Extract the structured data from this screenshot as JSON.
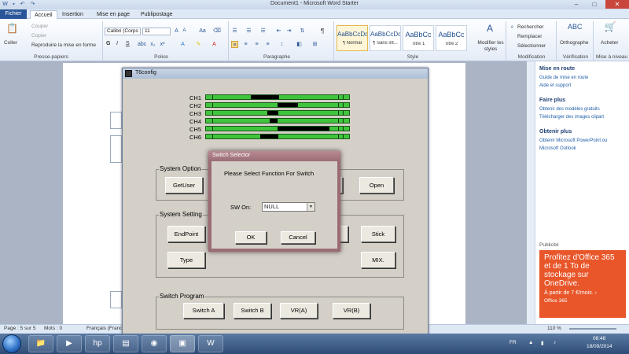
{
  "word": {
    "title": "Document1 - Microsoft Word Starter",
    "tabs": [
      "Fichier",
      "Accueil",
      "Insertion",
      "Mise en page",
      "Publipostage"
    ],
    "clipboard": {
      "paste": "Coller",
      "cut": "Couper",
      "copy": "Copier",
      "format_painter": "Reproduire la mise en forme",
      "label": "Presse-papiers"
    },
    "font": {
      "name": "Calibri (Corps",
      "size": "11",
      "label": "Police",
      "bold": "G",
      "italic": "I",
      "underline": "S"
    },
    "paragraph": {
      "label": "Paragraphe",
      "pilcrow": "¶"
    },
    "styles": {
      "label": "Style",
      "items": [
        {
          "sample": "AaBbCcDc",
          "name": "¶ Normal"
        },
        {
          "sample": "AaBbCcDc",
          "name": "¶ Sans int..."
        },
        {
          "sample": "AaBbCc",
          "name": "Titre 1"
        },
        {
          "sample": "AaBbCc",
          "name": "Titre 2"
        }
      ],
      "modify": "Modifier les styles"
    },
    "editing": {
      "find": "Rechercher",
      "replace": "Remplacer",
      "select": "Sélectionner",
      "label": "Modification"
    },
    "proofing": {
      "spelling": "Orthographe",
      "label": "Vérification"
    },
    "buy": {
      "label": "Acheter",
      "group": "Mise à niveau"
    },
    "status": {
      "page": "Page : 5 sur 5",
      "words": "Mots : 0",
      "lang": "Français (France)",
      "zoom": "110 %"
    }
  },
  "pane": {
    "get_started": "Mise en route",
    "get_started_links": [
      "Guide de mise en route",
      "Aide et support"
    ],
    "do_more": "Faire plus",
    "do_more_links": [
      "Obtenir des modèles gratuits",
      "Télécharger des images clipart"
    ],
    "get_more": "Obtenir plus",
    "get_more_links": [
      "Obtenir Microsoft PowerPoint ou",
      "Microsoft Outlook"
    ],
    "ad_label": "Publicité",
    "ad_text": "Profitez d'Office 365 et de 1 To de stockage sur OneDrive.",
    "ad_price": "À partir de 7 €/mois. ›",
    "ad_brand": "Office 365"
  },
  "t6": {
    "title": "T6config",
    "channels": [
      "CH1",
      "CH2",
      "CH3",
      "CH4",
      "CH5",
      "CH6"
    ],
    "system_option": {
      "label": "System Option",
      "getuser": "GetUser",
      "open": "Open"
    },
    "system_setting": {
      "label": "System Setting",
      "endpoint": "EndPoint",
      "type": "Type",
      "stick": "Stick",
      "mix": "MIX."
    },
    "switch_program": {
      "label": "Switch Program",
      "buttons": [
        "Switch A",
        "Switch B",
        "VR(A)",
        "VR(B)"
      ]
    }
  },
  "dialog": {
    "title": "Switch Selector",
    "prompt": "Please Select Function For  Switch",
    "sw_label": "SW On:",
    "sw_value": "NULL",
    "ok": "OK",
    "cancel": "Cancel"
  },
  "taskbar": {
    "lang": "FR",
    "time": "08:48",
    "date": "18/09/2014"
  }
}
